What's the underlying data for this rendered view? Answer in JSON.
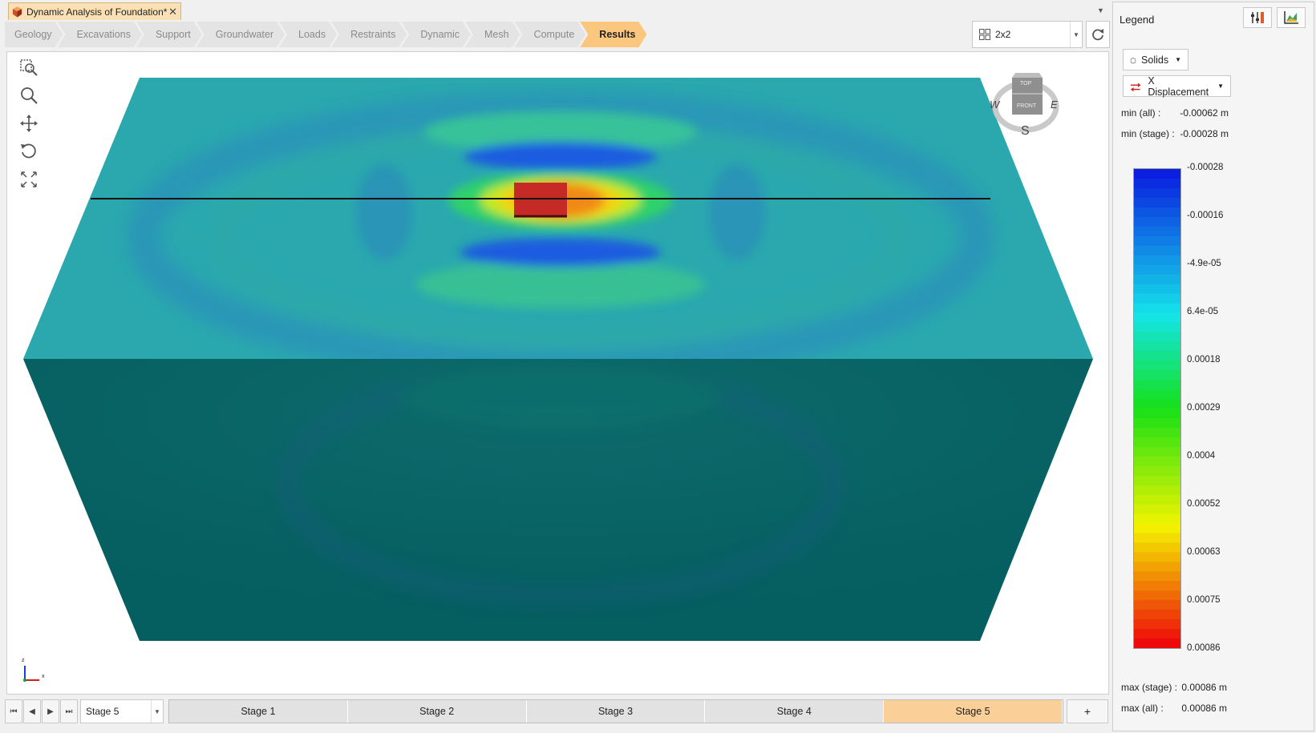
{
  "document": {
    "title": "Dynamic Analysis of Foundation*",
    "close": "✕"
  },
  "workflow_tabs": [
    {
      "label": "Geology"
    },
    {
      "label": "Excavations"
    },
    {
      "label": "Support"
    },
    {
      "label": "Groundwater"
    },
    {
      "label": "Loads"
    },
    {
      "label": "Restraints"
    },
    {
      "label": "Dynamic"
    },
    {
      "label": "Mesh"
    },
    {
      "label": "Compute"
    },
    {
      "label": "Results",
      "active": true
    }
  ],
  "layout_select": {
    "value": "2x2"
  },
  "compass": {
    "top": "TOP",
    "front": "FRONT",
    "west": "W",
    "east": "E",
    "south": "S"
  },
  "axis_triad": {
    "z": "z",
    "x": "x"
  },
  "stage_nav": {
    "selected": "Stage 5",
    "add_label": "+"
  },
  "stages": [
    {
      "label": "Stage 1"
    },
    {
      "label": "Stage 2"
    },
    {
      "label": "Stage 3"
    },
    {
      "label": "Stage 4"
    },
    {
      "label": "Stage 5",
      "active": true
    }
  ],
  "legend": {
    "title": "Legend",
    "solids_label": "Solids",
    "result_label": "X Displacement",
    "min_all_label": "min (all) :",
    "min_all_value": "-0.00062 m",
    "min_stage_label": "min (stage) :",
    "min_stage_value": "-0.00028 m",
    "max_stage_label": "max (stage) :",
    "max_stage_value": "0.00086 m",
    "max_all_label": "max (all) :",
    "max_all_value": "0.00086 m",
    "ticks": [
      "-0.00028",
      "-0.00016",
      "-4.9e-05",
      "6.4e-05",
      "0.00018",
      "0.00029",
      "0.0004",
      "0.00052",
      "0.00063",
      "0.00075",
      "0.00086"
    ],
    "colors": {
      "blue": "#0b1fe0",
      "cyan": "#14e4ea",
      "green": "#16e016",
      "yellow": "#f4f400",
      "red": "#ee0a0a"
    }
  }
}
